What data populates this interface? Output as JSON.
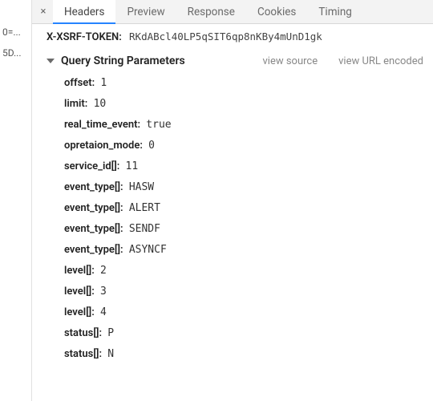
{
  "left_panel": {
    "items": [
      "0=...",
      "5D..."
    ]
  },
  "tabs": {
    "close_glyph": "×",
    "items": [
      {
        "label": "Headers",
        "active": true
      },
      {
        "label": "Preview",
        "active": false
      },
      {
        "label": "Response",
        "active": false
      },
      {
        "label": "Cookies",
        "active": false
      },
      {
        "label": "Timing",
        "active": false
      }
    ]
  },
  "header_line": {
    "name": "X-XSRF-TOKEN:",
    "value": "RKdABcl40LP5qSIT6qp8nKBy4mUnD1gk"
  },
  "section": {
    "title": "Query String Parameters",
    "actions": {
      "view_source": "view source",
      "view_url_encoded": "view URL encoded"
    }
  },
  "params": [
    {
      "name": "offset:",
      "value": "1"
    },
    {
      "name": "limit:",
      "value": "10"
    },
    {
      "name": "real_time_event:",
      "value": "true"
    },
    {
      "name": "opretaion_mode:",
      "value": "0"
    },
    {
      "name": "service_id[]:",
      "value": "11"
    },
    {
      "name": "event_type[]:",
      "value": "HASW"
    },
    {
      "name": "event_type[]:",
      "value": "ALERT"
    },
    {
      "name": "event_type[]:",
      "value": "SENDF"
    },
    {
      "name": "event_type[]:",
      "value": "ASYNCF"
    },
    {
      "name": "level[]:",
      "value": "2"
    },
    {
      "name": "level[]:",
      "value": "3"
    },
    {
      "name": "level[]:",
      "value": "4"
    },
    {
      "name": "status[]:",
      "value": "P"
    },
    {
      "name": "status[]:",
      "value": "N"
    }
  ]
}
